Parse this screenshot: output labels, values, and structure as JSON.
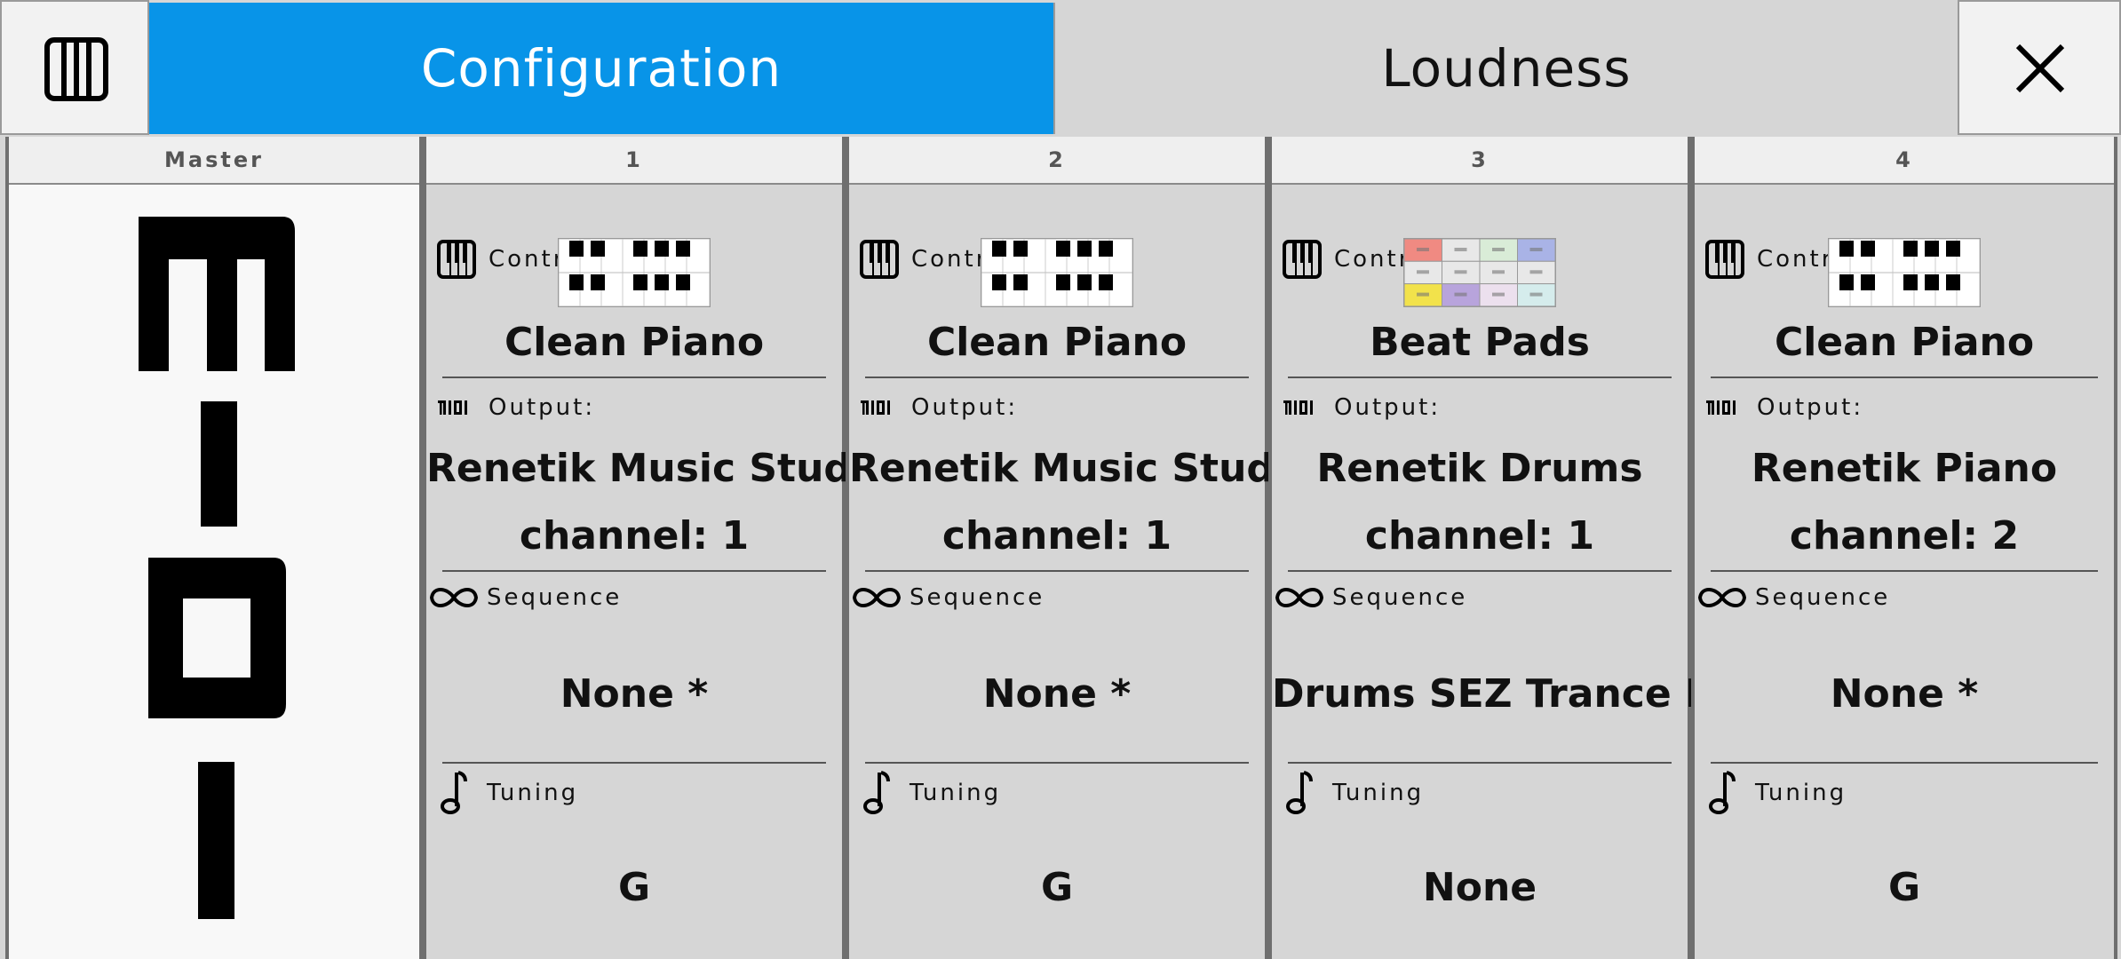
{
  "header": {
    "tabs": [
      {
        "label": "Configuration",
        "active": true
      },
      {
        "label": "Loudness",
        "active": false
      }
    ],
    "accent_color": "#0894e8"
  },
  "labels": {
    "controller": "Controller",
    "output": "Output:",
    "sequence": "Sequence",
    "tuning": "Tuning",
    "midi_badge": "MIDI"
  },
  "master": {
    "header": "Master",
    "logo_text": "MIDI"
  },
  "channels": [
    {
      "header": "1",
      "controller": "Clean Piano",
      "controller_image": "piano-keyboard",
      "output_device": "Renetik Music Studio",
      "output_channel": "channel: 1",
      "sequence": "None *",
      "tuning": "G"
    },
    {
      "header": "2",
      "controller": "Clean Piano",
      "controller_image": "piano-keyboard",
      "output_device": "Renetik Music Studio",
      "output_channel": "channel: 1",
      "sequence": "None *",
      "tuning": "G"
    },
    {
      "header": "3",
      "controller": "Beat Pads",
      "controller_image": "drum-pads",
      "output_device": "Renetik Drums",
      "output_channel": "channel: 1",
      "sequence": "Drums SEZ Trance I *",
      "tuning": "None"
    },
    {
      "header": "4",
      "controller": "Clean Piano",
      "controller_image": "piano-keyboard",
      "output_device": "Renetik Piano",
      "output_channel": "channel: 2",
      "sequence": "None *",
      "tuning": "G"
    }
  ]
}
